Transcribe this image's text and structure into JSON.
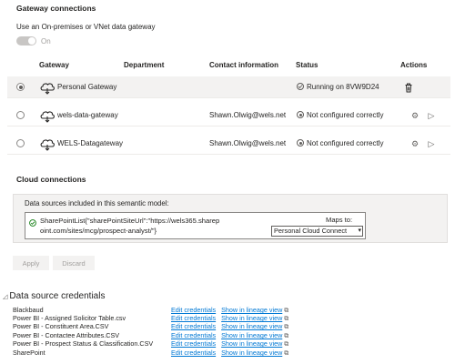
{
  "gateway_connections": {
    "title": "Gateway connections",
    "onprem_label": "Use an On-premises or VNet data gateway",
    "toggle_label": "On",
    "columns": {
      "gateway": "Gateway",
      "department": "Department",
      "contact": "Contact information",
      "status": "Status",
      "actions": "Actions"
    },
    "rows": [
      {
        "name": "Personal Gateway",
        "contact": "",
        "status": "Running on 8VW9D24",
        "selected": true
      },
      {
        "name": "wels-data-gateway",
        "contact": "Shawn.Olwig@wels.net",
        "status": "Not configured correctly",
        "selected": false
      },
      {
        "name": "WELS-Datagateway",
        "contact": "Shawn.Olwig@wels.net",
        "status": "Not configured correctly",
        "selected": false
      }
    ]
  },
  "cloud_connections": {
    "title": "Cloud connections",
    "included_label": "Data sources included in this semantic model:",
    "source_line1": "SharePointList{\"sharePointSiteUrl\":\"https://wels365.sharep",
    "source_line2": "oint.com/sites/mcg/prospect-analyst/\"}",
    "maps_to_label": "Maps to:",
    "maps_to_value": "Personal Cloud Connect"
  },
  "buttons": {
    "apply": "Apply",
    "discard": "Discard"
  },
  "credentials": {
    "title": "Data source credentials",
    "edit_label": "Edit credentials",
    "lineage_label": "Show in lineage view",
    "sources": [
      {
        "name": "Blackbaud"
      },
      {
        "name": "Power BI - Assigned Solicitor Table.csv"
      },
      {
        "name": "Power BI - Constituent Area.CSV"
      },
      {
        "name": "Power BI - Contactee Attributes.CSV"
      },
      {
        "name": "Power BI - Prospect Status & Classification.CSV"
      },
      {
        "name": "SharePoint"
      }
    ]
  }
}
